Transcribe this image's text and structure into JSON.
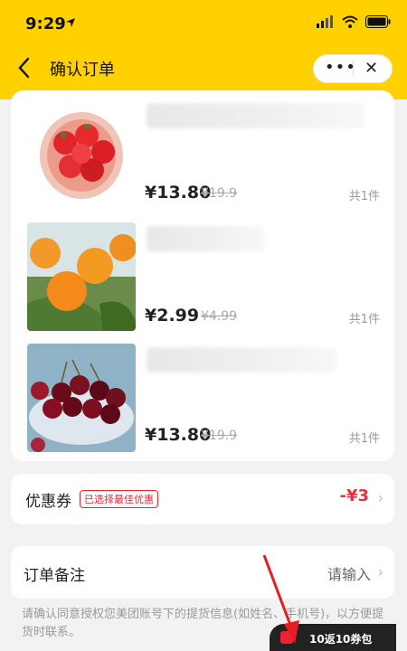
{
  "status_bar": {
    "time": "9:29"
  },
  "nav": {
    "title": "确认订单",
    "more_label": "•••",
    "close_label": "✕"
  },
  "items": [
    {
      "price": "¥13.80",
      "old_price": "¥19.9",
      "quantity": "共1件",
      "image": "strawberries"
    },
    {
      "price": "¥2.99",
      "old_price": "¥4.99",
      "quantity": "共1件",
      "image": "oranges"
    },
    {
      "price": "¥13.80",
      "old_price": "¥19.9",
      "quantity": "共1件",
      "image": "cherries"
    }
  ],
  "coupon": {
    "label": "优惠券",
    "badge": "已选择最佳优惠",
    "value": "-¥3"
  },
  "notes": {
    "label": "订单备注",
    "placeholder": "请输入"
  },
  "consent_text": "请确认同意授权您美团账号下的提货信息(如姓名、手机号)，以方便提货时联系。",
  "promo_text": "10返10券包",
  "colors": {
    "brand_yellow": "#ffd100",
    "price_red": "#e8313c"
  }
}
